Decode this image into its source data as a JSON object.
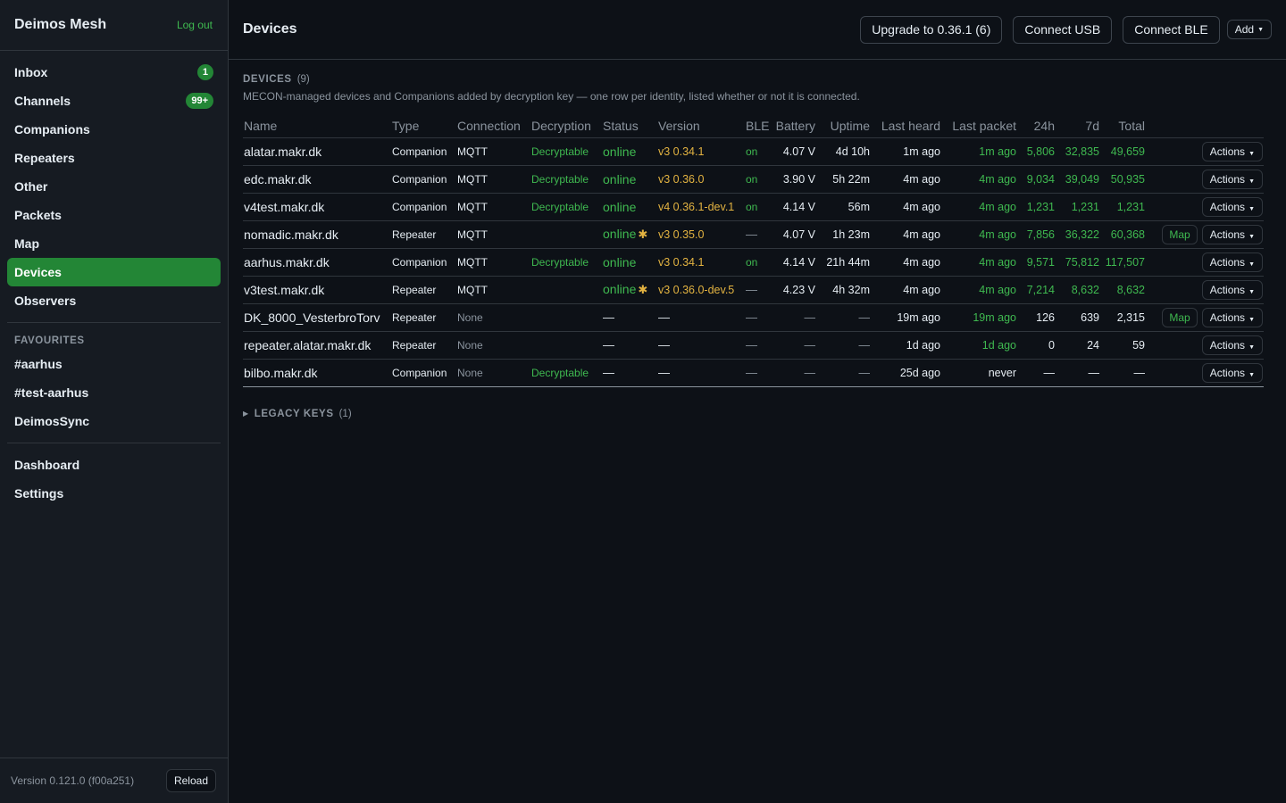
{
  "sidebar": {
    "brand": "Deimos Mesh",
    "logout": "Log out",
    "nav": [
      {
        "label": "Inbox",
        "badge": "1"
      },
      {
        "label": "Channels",
        "badge": "99+"
      },
      {
        "label": "Companions"
      },
      {
        "label": "Repeaters"
      },
      {
        "label": "Other"
      },
      {
        "label": "Packets"
      },
      {
        "label": "Map"
      },
      {
        "label": "Devices",
        "active": true
      },
      {
        "label": "Observers"
      }
    ],
    "favourites_title": "FAVOURITES",
    "favourites": [
      "#aarhus",
      "#test-aarhus",
      "DeimosSync"
    ],
    "bottom_nav": [
      "Dashboard",
      "Settings"
    ],
    "version": "Version 0.121.0 (f00a251)",
    "reload": "Reload"
  },
  "header": {
    "title": "Devices",
    "upgrade": "Upgrade to 0.36.1 (6)",
    "connect_usb": "Connect USB",
    "connect_ble": "Connect BLE",
    "add": "Add"
  },
  "section": {
    "title": "DEVICES",
    "count": "(9)",
    "description": "MECON-managed devices and Companions added by decryption key — one row per identity, listed whether or not it is connected."
  },
  "table": {
    "columns": [
      "Name",
      "Type",
      "Connection",
      "Decryption",
      "Status",
      "Version",
      "BLE",
      "Battery",
      "Uptime",
      "Last heard",
      "Last packet",
      "24h",
      "7d",
      "Total",
      ""
    ],
    "rows": [
      {
        "name": "alatar.makr.dk",
        "type": "Companion",
        "conn": "MQTT",
        "decrypt": "Decryptable",
        "status": "online",
        "star": false,
        "version": "v3 0.34.1",
        "ble": "on",
        "battery": "4.07 V",
        "uptime": "4d 10h",
        "heard": "1m ago",
        "packet": "1m ago",
        "d24": "5,806",
        "d7": "32,835",
        "total": "49,659",
        "map": false,
        "active": true
      },
      {
        "name": "edc.makr.dk",
        "type": "Companion",
        "conn": "MQTT",
        "decrypt": "Decryptable",
        "status": "online",
        "star": false,
        "version": "v3 0.36.0",
        "ble": "on",
        "battery": "3.90 V",
        "uptime": "5h 22m",
        "heard": "4m ago",
        "packet": "4m ago",
        "d24": "9,034",
        "d7": "39,049",
        "total": "50,935",
        "map": false,
        "active": true
      },
      {
        "name": "v4test.makr.dk",
        "type": "Companion",
        "conn": "MQTT",
        "decrypt": "Decryptable",
        "status": "online",
        "star": false,
        "version": "v4 0.36.1-dev.1",
        "ble": "on",
        "battery": "4.14 V",
        "uptime": "56m",
        "heard": "4m ago",
        "packet": "4m ago",
        "d24": "1,231",
        "d7": "1,231",
        "total": "1,231",
        "map": false,
        "active": true
      },
      {
        "name": "nomadic.makr.dk",
        "type": "Repeater",
        "conn": "MQTT",
        "decrypt": "",
        "status": "online",
        "star": true,
        "version": "v3 0.35.0",
        "ble": "—",
        "battery": "4.07 V",
        "uptime": "1h 23m",
        "heard": "4m ago",
        "packet": "4m ago",
        "d24": "7,856",
        "d7": "36,322",
        "total": "60,368",
        "map": true,
        "active": true
      },
      {
        "name": "aarhus.makr.dk",
        "type": "Companion",
        "conn": "MQTT",
        "decrypt": "Decryptable",
        "status": "online",
        "star": false,
        "version": "v3 0.34.1",
        "ble": "on",
        "battery": "4.14 V",
        "uptime": "21h 44m",
        "heard": "4m ago",
        "packet": "4m ago",
        "d24": "9,571",
        "d7": "75,812",
        "total": "117,507",
        "map": false,
        "active": true
      },
      {
        "name": "v3test.makr.dk",
        "type": "Repeater",
        "conn": "MQTT",
        "decrypt": "",
        "status": "online",
        "star": true,
        "version": "v3 0.36.0-dev.5",
        "ble": "—",
        "battery": "4.23 V",
        "uptime": "4h 32m",
        "heard": "4m ago",
        "packet": "4m ago",
        "d24": "7,214",
        "d7": "8,632",
        "total": "8,632",
        "map": false,
        "active": true
      },
      {
        "name": "DK_8000_VesterbroTorv",
        "type": "Repeater",
        "conn": "None",
        "decrypt": "",
        "status": "—",
        "star": false,
        "version": "—",
        "ble": "—",
        "battery": "—",
        "uptime": "—",
        "heard": "19m ago",
        "packet": "19m ago",
        "d24": "126",
        "d7": "639",
        "total": "2,315",
        "map": true,
        "active": false
      },
      {
        "name": "repeater.alatar.makr.dk",
        "type": "Repeater",
        "conn": "None",
        "decrypt": "",
        "status": "—",
        "star": false,
        "version": "—",
        "ble": "—",
        "battery": "—",
        "uptime": "—",
        "heard": "1d ago",
        "packet": "1d ago",
        "d24": "0",
        "d7": "24",
        "total": "59",
        "map": false,
        "active": false
      },
      {
        "name": "bilbo.makr.dk",
        "type": "Companion",
        "conn": "None",
        "decrypt": "Decryptable",
        "status": "—",
        "star": false,
        "version": "—",
        "ble": "—",
        "battery": "—",
        "uptime": "—",
        "heard": "25d ago",
        "packet": "never",
        "d24": "—",
        "d7": "—",
        "total": "—",
        "map": false,
        "active": false
      }
    ],
    "map_label": "Map",
    "actions_label": "Actions"
  },
  "legacy": {
    "title": "LEGACY KEYS",
    "count": "(1)"
  },
  "colors": {
    "accent": "#238636",
    "green_text": "#3fb950",
    "version_yellow": "#e3b341",
    "bg": "#0d1117",
    "sidebar_bg": "#161b22"
  },
  "icons": {
    "star": "star-icon",
    "caret": "caret-down-icon",
    "disclosure": "triangle-right-icon"
  }
}
